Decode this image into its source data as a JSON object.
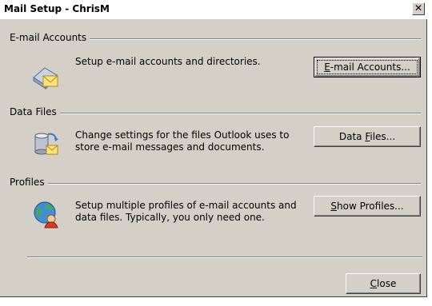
{
  "window": {
    "title": "Mail Setup - ChrisM"
  },
  "sections": [
    {
      "label": "E-mail Accounts",
      "description": "Setup e-mail accounts and directories.",
      "button": {
        "label": "E-mail Accounts...",
        "mnemonic": "E",
        "rest": "-mail Accounts..."
      },
      "icon": "email-accounts-icon"
    },
    {
      "label": "Data Files",
      "description": "Change settings for the files Outlook uses to store e-mail messages and documents.",
      "button": {
        "label": "Data Files...",
        "before": "Data ",
        "mnemonic": "F",
        "rest": "iles..."
      },
      "icon": "data-files-icon"
    },
    {
      "label": "Profiles",
      "description": "Setup multiple profiles of e-mail accounts and data files. Typically, you only need one.",
      "button": {
        "label": "Show Profiles...",
        "mnemonic": "S",
        "rest": "how Profiles..."
      },
      "icon": "profiles-icon"
    }
  ],
  "footer": {
    "close": {
      "label": "Close",
      "mnemonic": "C",
      "rest": "lose"
    }
  },
  "colors": {
    "face": "#d4d0c8",
    "shadow": "#808080",
    "highlight": "#ffffff"
  }
}
